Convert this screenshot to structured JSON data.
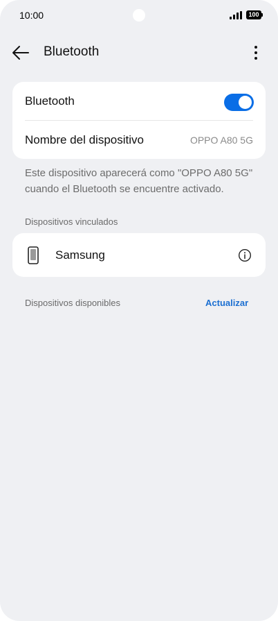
{
  "status_bar": {
    "time": "10:00",
    "battery": "100"
  },
  "header": {
    "title": "Bluetooth"
  },
  "bluetooth_row": {
    "label": "Bluetooth",
    "enabled": true
  },
  "device_name_row": {
    "label": "Nombre del dispositivo",
    "value": "OPPO A80 5G"
  },
  "helper_text": "Este dispositivo aparecerá como \"OPPO A80 5G\" cuando el Bluetooth se encuentre activado.",
  "paired_section": {
    "label": "Dispositivos vinculados",
    "devices": [
      {
        "name": "Samsung",
        "icon": "phone-icon"
      }
    ]
  },
  "available_section": {
    "label": "Dispositivos disponibles",
    "refresh_label": "Actualizar"
  },
  "colors": {
    "accent": "#0a6ee6",
    "link": "#1b6fd1",
    "background": "#eff0f3"
  }
}
